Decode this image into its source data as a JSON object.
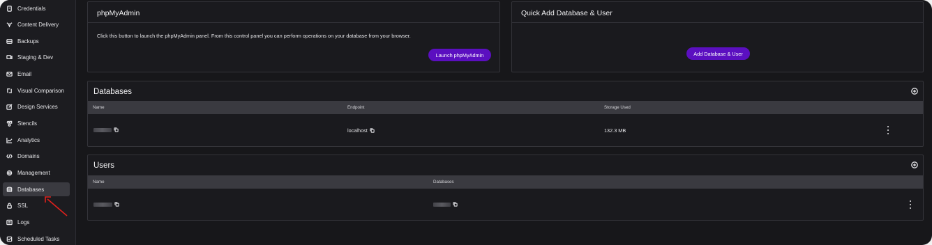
{
  "sidebar": {
    "items": [
      {
        "label": "Credentials",
        "icon": "key-icon"
      },
      {
        "label": "Content Delivery",
        "icon": "network-icon"
      },
      {
        "label": "Backups",
        "icon": "archive-icon"
      },
      {
        "label": "Staging & Dev",
        "icon": "monitor-icon"
      },
      {
        "label": "Email",
        "icon": "mail-icon"
      },
      {
        "label": "Visual Comparison",
        "icon": "compare-icon"
      },
      {
        "label": "Design Services",
        "icon": "edit-icon"
      },
      {
        "label": "Stencils",
        "icon": "stencil-icon"
      },
      {
        "label": "Analytics",
        "icon": "chart-icon"
      },
      {
        "label": "Domains",
        "icon": "code-icon"
      },
      {
        "label": "Management",
        "icon": "gear-icon"
      },
      {
        "label": "Databases",
        "icon": "database-icon",
        "active": true
      },
      {
        "label": "SSL",
        "icon": "lock-icon"
      },
      {
        "label": "Logs",
        "icon": "list-icon"
      },
      {
        "label": "Scheduled Tasks",
        "icon": "checklist-icon"
      }
    ]
  },
  "phpmyadmin": {
    "title": "phpMyAdmin",
    "description": "Click this button to launch the phpMyAdmin panel. From this control panel you can perform operations on your database from your browser.",
    "button": "Launch phpMyAdmin"
  },
  "quick_add": {
    "title": "Quick Add Database & User",
    "button": "Add Database & User"
  },
  "databases": {
    "title": "Databases",
    "columns": [
      "Name",
      "Endpoint",
      "Storage Used"
    ],
    "rows": [
      {
        "name": "",
        "endpoint": "localhost",
        "storage": "132.3 MB"
      }
    ]
  },
  "users": {
    "title": "Users",
    "columns": [
      "Name",
      "Databases"
    ],
    "rows": [
      {
        "name": "",
        "databases": ""
      }
    ]
  },
  "colors": {
    "accent": "#5b0fc0",
    "annotation_arrow": "#e0201c"
  }
}
